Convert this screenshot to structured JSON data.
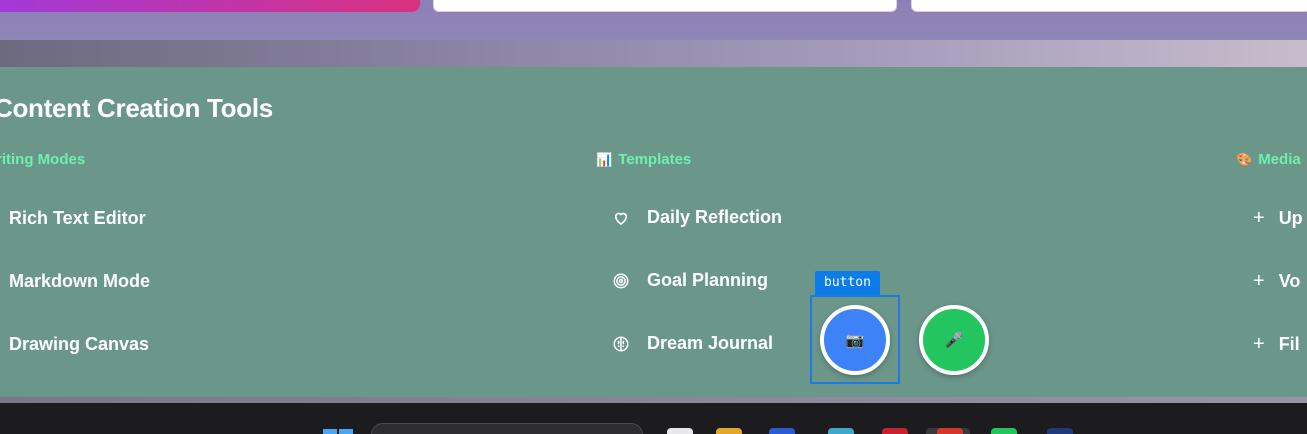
{
  "section": {
    "title": "Content Creation Tools"
  },
  "columns": [
    {
      "heading": "riting Modes",
      "heading_icon": "",
      "items": [
        {
          "label": "Rich Text Editor",
          "icon": "none"
        },
        {
          "label": "Markdown Mode",
          "icon": "none"
        },
        {
          "label": "Drawing Canvas",
          "icon": "none"
        }
      ]
    },
    {
      "heading": "Templates",
      "heading_icon": "📊",
      "items": [
        {
          "label": "Daily Reflection",
          "icon": "heart-icon"
        },
        {
          "label": "Goal Planning",
          "icon": "target-icon"
        },
        {
          "label": "Dream Journal",
          "icon": "brain-icon"
        }
      ]
    },
    {
      "heading": "Media",
      "heading_icon": "🎨",
      "items": [
        {
          "label": "Up",
          "icon": "plus-icon"
        },
        {
          "label": "Vo",
          "icon": "plus-icon"
        },
        {
          "label": "Fil",
          "icon": "plus-icon"
        }
      ]
    }
  ],
  "plus_glyph": "+",
  "fabs": {
    "camera_glyph": "📷",
    "mic_glyph": "🎤",
    "camera_color": "#3d82f6",
    "mic_color": "#22c55e"
  },
  "inspector": {
    "tooltip_label": "button"
  },
  "colors": {
    "panel": "#6b978b",
    "heading_accent": "#6ff0b0",
    "band": "#8f7fb8",
    "highlight": "#1f7ae0"
  }
}
